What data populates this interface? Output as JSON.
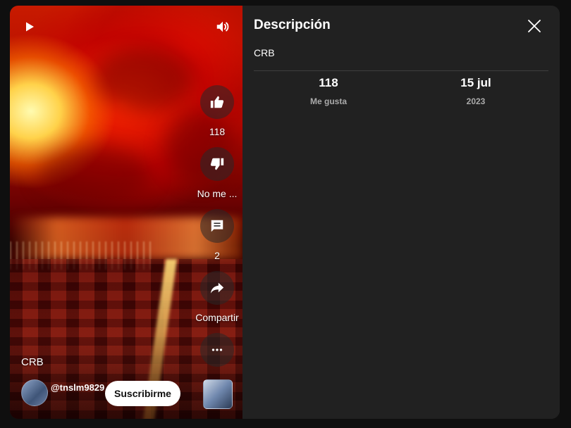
{
  "video": {
    "title": "CRB",
    "channel_handle": "@tnslm9829",
    "subscribe_label": "Suscribirme",
    "play_icon": "play-icon",
    "volume_icon": "volume-icon"
  },
  "actions": [
    {
      "icon": "thumbs-up-icon",
      "label": "118"
    },
    {
      "icon": "thumbs-down-icon",
      "label": "No me ..."
    },
    {
      "icon": "comment-icon",
      "label": "2"
    },
    {
      "icon": "share-icon",
      "label": "Compartir"
    },
    {
      "icon": "more-icon",
      "label": ""
    }
  ],
  "panel": {
    "title": "Descripción",
    "description": "CRB",
    "stats": [
      {
        "value": "118",
        "caption": "Me gusta"
      },
      {
        "value": "15 jul",
        "caption": "2023"
      }
    ],
    "close_icon": "close-icon"
  },
  "colors": {
    "background": "#0f0f0f",
    "panel": "#212121",
    "subscribe_bg": "#ffffff",
    "caption": "#aaaaaa"
  }
}
